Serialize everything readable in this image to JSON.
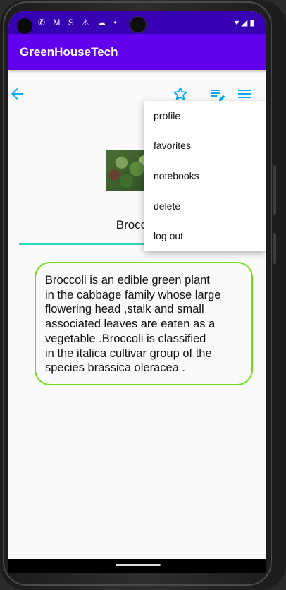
{
  "app": {
    "title": "GreenHouseTech"
  },
  "toolbar": {
    "back_icon": "arrow-left-icon",
    "favorite_icon": "star-outline-icon",
    "notes_icon": "playlist-edit-icon",
    "menu_icon": "hamburger-menu-icon",
    "accent": "#03a9f4"
  },
  "plant": {
    "name": "Broccoli",
    "description": "Broccoli is an edible green plant\nin the cabbage family whose large\nflowering head ,stalk and small\nassociated leaves are eaten as a\nvegetable .Broccoli is classified\nin the italica cultivar group of the\nspecies brassica oleracea  ."
  },
  "menu": {
    "items": [
      {
        "label": "profile"
      },
      {
        "label": "favorites"
      },
      {
        "label": "notebooks"
      },
      {
        "label": "delete"
      },
      {
        "label": "log out"
      }
    ]
  },
  "colors": {
    "status_bar": "#3700b3",
    "app_bar": "#6200ee",
    "underline": "#2cd6b8",
    "desc_border": "#6fdc18"
  }
}
